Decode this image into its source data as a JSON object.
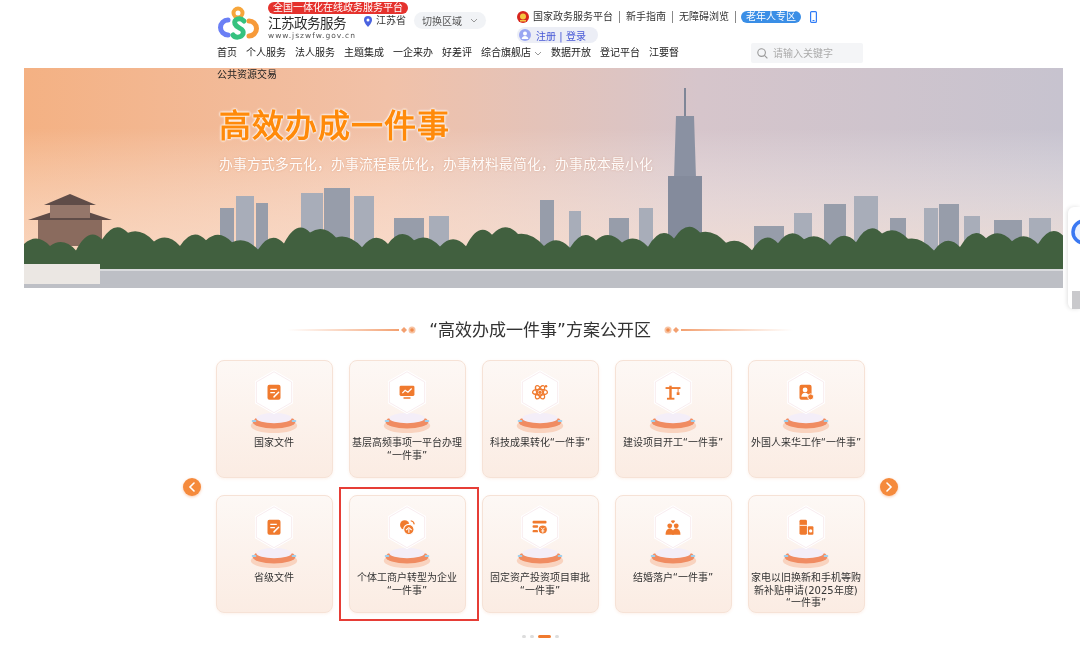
{
  "header": {
    "badge": "全国一体化在线政务服务平台",
    "site_name": "江苏政务服务",
    "site_url": "www.jszwfw.gov.cn",
    "location": "江苏省",
    "region_switch": "切换区域",
    "top_links": [
      {
        "label": "国家政务服务平台",
        "kind": "emblem"
      },
      {
        "label": "新手指南",
        "kind": "link"
      },
      {
        "label": "无障碍浏览",
        "kind": "link"
      },
      {
        "label": "老年人专区",
        "kind": "pill"
      }
    ],
    "account": "注册 | 登录"
  },
  "nav": {
    "items": [
      {
        "label": "首页",
        "dropdown": false
      },
      {
        "label": "个人服务",
        "dropdown": false
      },
      {
        "label": "法人服务",
        "dropdown": false
      },
      {
        "label": "主题集成",
        "dropdown": false
      },
      {
        "label": "一企来办",
        "dropdown": false
      },
      {
        "label": "好差评",
        "dropdown": false
      },
      {
        "label": "综合旗舰店",
        "dropdown": true
      },
      {
        "label": "数据开放",
        "dropdown": false
      },
      {
        "label": "登记平台",
        "dropdown": false
      },
      {
        "label": "江要督",
        "dropdown": false
      },
      {
        "label": "公共资源交易",
        "dropdown": false
      }
    ],
    "search": {
      "placeholder": "请输入关键字"
    }
  },
  "banner": {
    "title": "高效办成一件事",
    "subtitle": "办事方式多元化，办事流程最优化，办事材料最简化，办事成本最小化"
  },
  "section": {
    "title": "“高效办成一件事”方案公开区"
  },
  "cards": [
    {
      "label": "国家文件",
      "highlighted": false
    },
    {
      "label": "基层高频事项一平台办理“一件事”",
      "highlighted": false
    },
    {
      "label": "科技成果转化“一件事”",
      "highlighted": false
    },
    {
      "label": "建设项目开工“一件事”",
      "highlighted": false
    },
    {
      "label": "外国人来华工作“一件事”",
      "highlighted": false
    },
    {
      "label": "省级文件",
      "highlighted": false
    },
    {
      "label": "个体工商户转型为企业“一件事”",
      "highlighted": true
    },
    {
      "label": "固定资产投资项目审批“一件事”",
      "highlighted": false
    },
    {
      "label": "结婚落户“一件事”",
      "highlighted": false
    },
    {
      "label": "家电以旧换新和手机等购新补贴申请(2025年度)“一件事”",
      "highlighted": false
    }
  ],
  "pagination": [
    {
      "selected": false
    },
    {
      "selected": false
    },
    {
      "selected": true
    },
    {
      "selected": false
    }
  ]
}
